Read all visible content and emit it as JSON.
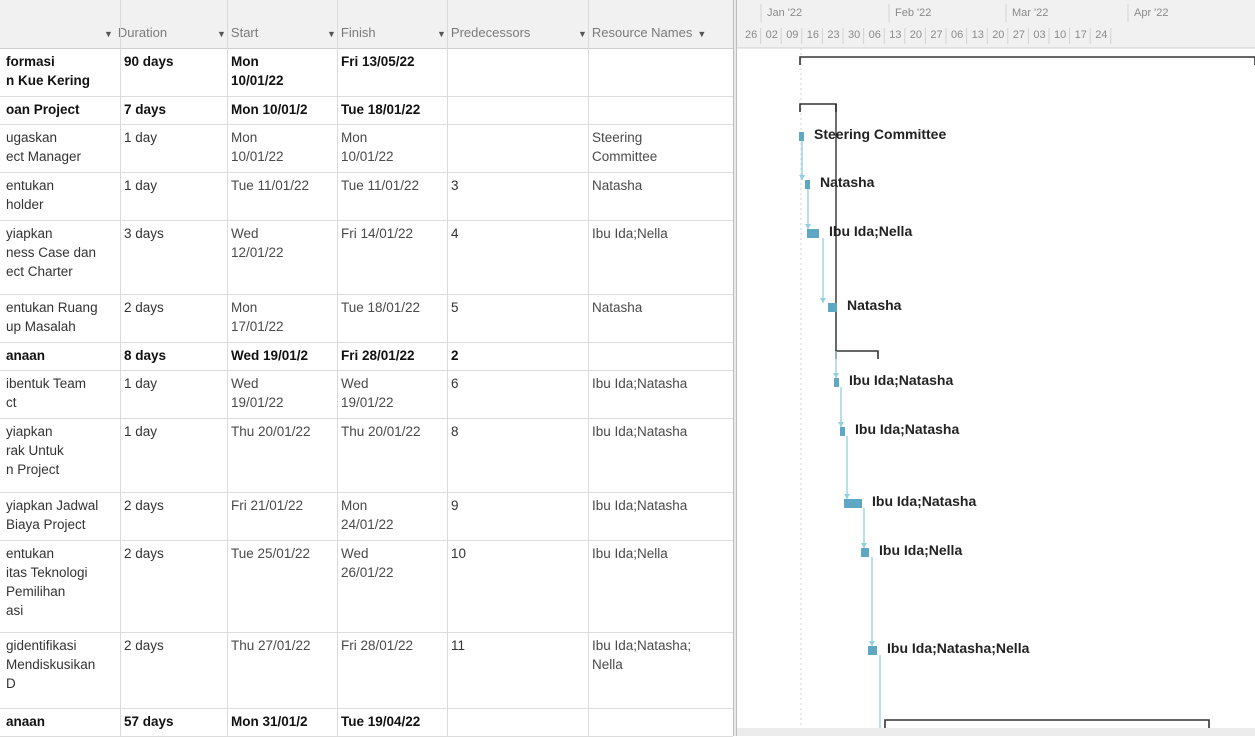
{
  "columns": {
    "duration": "Duration",
    "start": "Start",
    "finish": "Finish",
    "predecessors": "Predecessors",
    "resource_names": "Resource Names"
  },
  "timeline": {
    "months": [
      "Jan '22",
      "Feb '22",
      "Mar '22",
      "Apr '22"
    ],
    "weeks": [
      "26",
      "02",
      "09",
      "16",
      "23",
      "30",
      "06",
      "13",
      "20",
      "27",
      "06",
      "13",
      "20",
      "27",
      "03",
      "10",
      "17",
      "24"
    ]
  },
  "rows": [
    {
      "name": "formasi\nn Kue Kering",
      "duration": "90 days",
      "start": "Mon\n10/01/22",
      "finish": "Fri 13/05/22",
      "pred": "",
      "res": "",
      "summary": true
    },
    {
      "name": "oan Project",
      "duration": "7 days",
      "start": "Mon 10/01/2",
      "finish": "Tue 18/01/22",
      "pred": "",
      "res": "",
      "summary": true
    },
    {
      "name": "ugaskan\nect Manager",
      "duration": "1 day",
      "start": "Mon\n10/01/22",
      "finish": "Mon\n10/01/22",
      "pred": "",
      "res": "Steering\nCommittee",
      "summary": false
    },
    {
      "name": "entukan\nholder",
      "duration": "1 day",
      "start": "Tue 11/01/22",
      "finish": "Tue 11/01/22",
      "pred": "3",
      "res": "Natasha",
      "summary": false
    },
    {
      "name": "yiapkan\nness Case dan\nect Charter",
      "duration": "3 days",
      "start": "Wed\n12/01/22",
      "finish": "Fri 14/01/22",
      "pred": "4",
      "res": "Ibu Ida;Nella",
      "summary": false
    },
    {
      "name": "entukan Ruang\nup Masalah",
      "duration": "2 days",
      "start": "Mon\n17/01/22",
      "finish": "Tue 18/01/22",
      "pred": "5",
      "res": "Natasha",
      "summary": false
    },
    {
      "name": "anaan",
      "duration": "8 days",
      "start": "Wed 19/01/2",
      "finish": "Fri 28/01/22",
      "pred": "2",
      "res": "",
      "summary": true
    },
    {
      "name": "ibentuk Team\nct",
      "duration": "1 day",
      "start": "Wed\n19/01/22",
      "finish": "Wed\n19/01/22",
      "pred": "6",
      "res": "Ibu Ida;Natasha",
      "summary": false
    },
    {
      "name": "yiapkan\nrak Untuk\nn Project",
      "duration": "1 day",
      "start": "Thu 20/01/22",
      "finish": "Thu 20/01/22",
      "pred": "8",
      "res": "Ibu Ida;Natasha",
      "summary": false
    },
    {
      "name": "yiapkan Jadwal\nBiaya Project",
      "duration": "2 days",
      "start": "Fri 21/01/22",
      "finish": "Mon\n24/01/22",
      "pred": "9",
      "res": "Ibu Ida;Natasha",
      "summary": false
    },
    {
      "name": "entukan\nitas Teknologi\nPemilihan\nasi",
      "duration": "2 days",
      "start": "Tue 25/01/22",
      "finish": "Wed\n26/01/22",
      "pred": "10",
      "res": "Ibu Ida;Nella",
      "summary": false
    },
    {
      "name": "gidentifikasi\nMendiskusikan\nD",
      "duration": "2 days",
      "start": "Thu 27/01/22",
      "finish": "Fri 28/01/22",
      "pred": "11",
      "res": "Ibu Ida;Natasha;\nNella",
      "summary": false
    },
    {
      "name": "anaan",
      "duration": "57 days",
      "start": "Mon 31/01/2",
      "finish": "Tue 19/04/22",
      "pred": "",
      "res": "",
      "summary": true
    }
  ],
  "bar_labels": [
    "Steering Committee",
    "Natasha",
    "Ibu Ida;Nella",
    "Natasha",
    "Ibu Ida;Natasha",
    "Ibu Ida;Natasha",
    "Ibu Ida;Natasha",
    "Ibu Ida;Nella",
    "Ibu Ida;Natasha;Nella"
  ],
  "colors": {
    "bar": "#5fa8c4",
    "link": "#8fd0df",
    "summary": "#333333"
  }
}
